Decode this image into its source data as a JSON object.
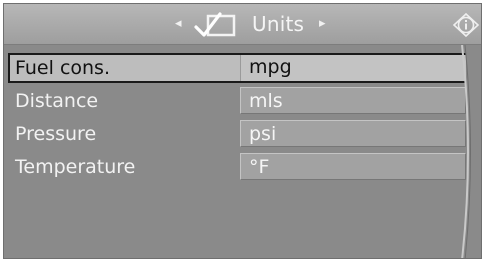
{
  "header": {
    "title": "Units",
    "left_arrow": "◂",
    "right_arrow": "▸",
    "menu_icon": "checkmark-box-icon",
    "info_icon": "info-icon"
  },
  "rows": [
    {
      "label": "Fuel cons.",
      "value": "mpg",
      "selected": true
    },
    {
      "label": "Distance",
      "value": "mls",
      "selected": false
    },
    {
      "label": "Pressure",
      "value": "psi",
      "selected": false
    },
    {
      "label": "Temperature",
      "value": "°F",
      "selected": false
    }
  ]
}
